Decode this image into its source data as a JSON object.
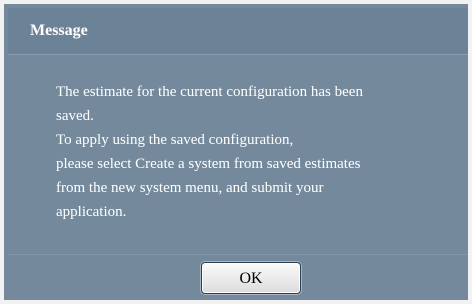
{
  "dialog": {
    "title": "Message",
    "message_lines": [
      "The estimate for the current configuration has been",
      "saved.",
      "To apply using the saved configuration,",
      "please select Create a system from saved estimates",
      "from the new system menu, and submit your",
      "application."
    ],
    "ok_label": "OK"
  },
  "colors": {
    "dialog_bg": "#74899c",
    "title_bg": "#6c8296",
    "text": "#ffffff",
    "border": "#f2f2f2"
  }
}
